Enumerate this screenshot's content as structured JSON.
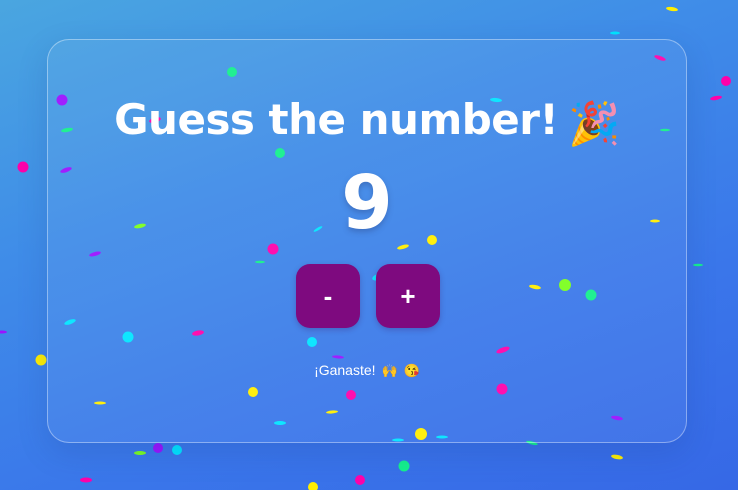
{
  "title": {
    "text": "Guess the number!",
    "emoji": "🎉",
    "emoji_name": "party-popper-icon"
  },
  "counter": {
    "value": "9"
  },
  "controls": {
    "decrement_label": "-",
    "increment_label": "+"
  },
  "status": {
    "message": "¡Ganaste!",
    "emoji_1": "🙌",
    "emoji_1_name": "raised-hands-icon",
    "emoji_2": "😘",
    "emoji_2_name": "kissing-face-icon"
  },
  "colors": {
    "button": "#7e0a7f",
    "confetti": [
      "#ff00aa",
      "#00e5ff",
      "#ffee00",
      "#14f08c",
      "#9b12ff",
      "#7cff1e"
    ]
  }
}
